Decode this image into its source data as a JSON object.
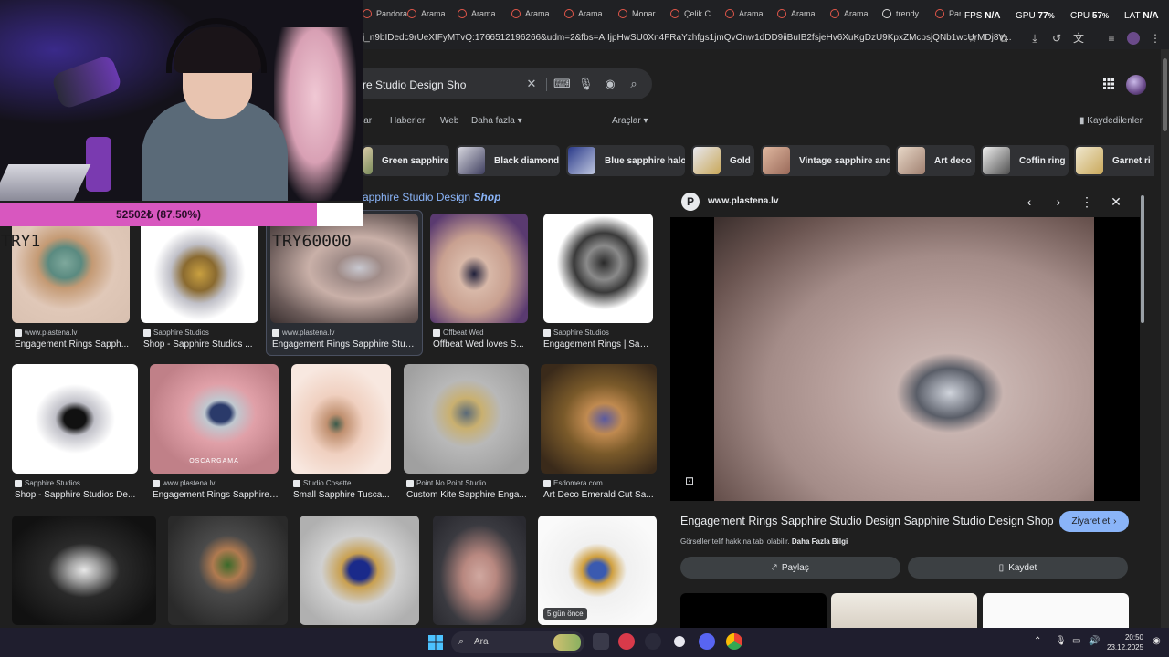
{
  "tabs": [
    {
      "label": "Pandora",
      "icon": "pandora-icon"
    },
    {
      "label": "Arama",
      "icon": "pandora-icon"
    },
    {
      "label": "Arama",
      "icon": "pandora-icon"
    },
    {
      "label": "Arama",
      "icon": "pandora-icon"
    },
    {
      "label": "Arama",
      "icon": "pandora-icon"
    },
    {
      "label": "Monar",
      "icon": "pandora-icon"
    },
    {
      "label": "Çelik C",
      "icon": "pandora-icon"
    },
    {
      "label": "Arama",
      "icon": "pandora-icon"
    },
    {
      "label": "Arama",
      "icon": "pandora-icon"
    },
    {
      "label": "Arama",
      "icon": "pandora-icon"
    },
    {
      "label": "trendy",
      "icon": "google-icon"
    },
    {
      "label": "Pando",
      "icon": "pandora-icon"
    }
  ],
  "address": {
    "url": "j_n9bIDedc9rUeXIFyMTvQ:1766512196266&udm=2&fbs=AIIjpHwSU0Xn4FRaYzhfgs1jmQvOnw1dDD9iiBuIB2fsjeHv6XuKgDzU9KpxZMcpsjQNb1wcUrMDj8V..."
  },
  "stats": {
    "fps_label": "FPS",
    "fps_value": "N/A",
    "gpu_label": "GPU",
    "gpu_value": "77",
    "cpu_label": "CPU",
    "cpu_value": "57",
    "lat_label": "LAT",
    "lat_value": "N/A",
    "unit": "%"
  },
  "search": {
    "query": "re Studio Design Sho"
  },
  "nav": {
    "tabs": [
      "lar",
      "Haberler",
      "Web",
      "Daha fazla"
    ],
    "tools": "Araçlar",
    "saved": "Kaydedilenler"
  },
  "chips": [
    "Green sapphire",
    "Black diamond",
    "Blue sapphire halo",
    "Gold",
    "Vintage sapphire and",
    "Art deco",
    "Coffin ring",
    "Garnet ri"
  ],
  "results": {
    "section_title": "apphire Studio Design",
    "section_title_em": "Shop",
    "items": [
      {
        "source": "www.plastena.lv",
        "title": "Engagement Rings Sapph..."
      },
      {
        "source": "Sapphire Studios",
        "title": "Shop - Sapphire Studios ..."
      },
      {
        "source": "www.plastena.lv",
        "title": "Engagement Rings Sapphire Studi..."
      },
      {
        "source": "Offbeat Wed",
        "title": "Offbeat Wed loves S..."
      },
      {
        "source": "Sapphire Studios",
        "title": "Engagement Rings | Sapp..."
      },
      {
        "source": "Sapphire Studios",
        "title": "Shop - Sapphire Studios De..."
      },
      {
        "source": "www.plastena.lv",
        "title": "Engagement Rings Sapphire ..."
      },
      {
        "source": "Studio Cosette",
        "title": "Small Sapphire Tusca..."
      },
      {
        "source": "Point No Point Studio",
        "title": "Custom Kite Sapphire Enga..."
      },
      {
        "source": "Esdomera.com",
        "title": "Art Deco Emerald Cut Sa..."
      }
    ],
    "image_watermark": "OSCARGAMA",
    "age_badge": "5 gün önce"
  },
  "preview": {
    "site": "www.plastena.lv",
    "logo": "P",
    "title": "Engagement Rings Sapphire Studio Design Sapphire Studio Design Shop",
    "visit": "Ziyaret et",
    "copyright": "Görseller telif hakkına tabi olabilir.",
    "learn_more": "Daha Fazla Bilgi",
    "share": "Paylaş",
    "save": "Kaydet"
  },
  "overlay": {
    "goal_text": "52502₺ (87.50%)",
    "goal_progress": 0.875,
    "try1": "TRY1",
    "try2": "TRY60000"
  },
  "taskbar": {
    "search_placeholder": "Ara",
    "time": "20:50",
    "date": "23.12.2025"
  },
  "colors": {
    "accent": "#8ab4f8",
    "goal_bar": "#d857bf"
  }
}
